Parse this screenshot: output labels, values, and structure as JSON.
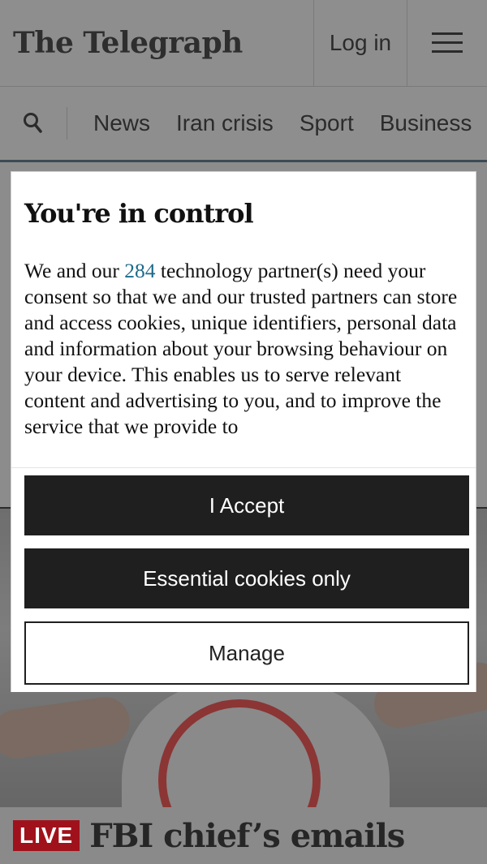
{
  "header": {
    "logo": "The Telegraph",
    "login_label": "Log in"
  },
  "nav": {
    "items": [
      "News",
      "Iran crisis",
      "Sport",
      "Business"
    ]
  },
  "consent": {
    "title": "You're in control",
    "body_before": "We and our ",
    "partner_count": "284",
    "body_after": " technology partner(s) need your consent so that we and our trusted partners can store and access cookies, unique identifiers, personal data and information about your browsing behaviour on your device. This enables us to serve relevant content and advertising to you, and to improve the service that we provide to",
    "accept_label": "I Accept",
    "essential_label": "Essential cookies only",
    "manage_label": "Manage"
  },
  "headline": {
    "live_badge": "LIVE",
    "title": "FBI chief’s emails"
  },
  "colors": {
    "accent_link": "#1d6a8a",
    "live_red": "#a0121b",
    "button_dark": "#1f1f1f"
  }
}
